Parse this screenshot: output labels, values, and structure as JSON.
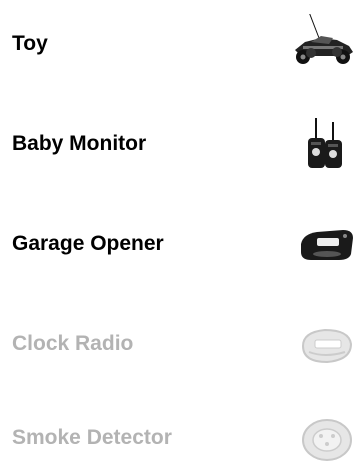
{
  "colors": {
    "active_text": "#000000",
    "inactive_text": "#b3b3b3",
    "background": "#ffffff"
  },
  "items": [
    {
      "label": "Toy",
      "icon": "rc-car-icon",
      "state": "active"
    },
    {
      "label": "Baby Monitor",
      "icon": "walkie-talkie-icon",
      "state": "active"
    },
    {
      "label": "Garage Opener",
      "icon": "garage-remote-icon",
      "state": "active"
    },
    {
      "label": "Clock Radio",
      "icon": "clock-radio-icon",
      "state": "inactive"
    },
    {
      "label": "Smoke Detector",
      "icon": "smoke-detector-icon",
      "state": "inactive"
    }
  ]
}
